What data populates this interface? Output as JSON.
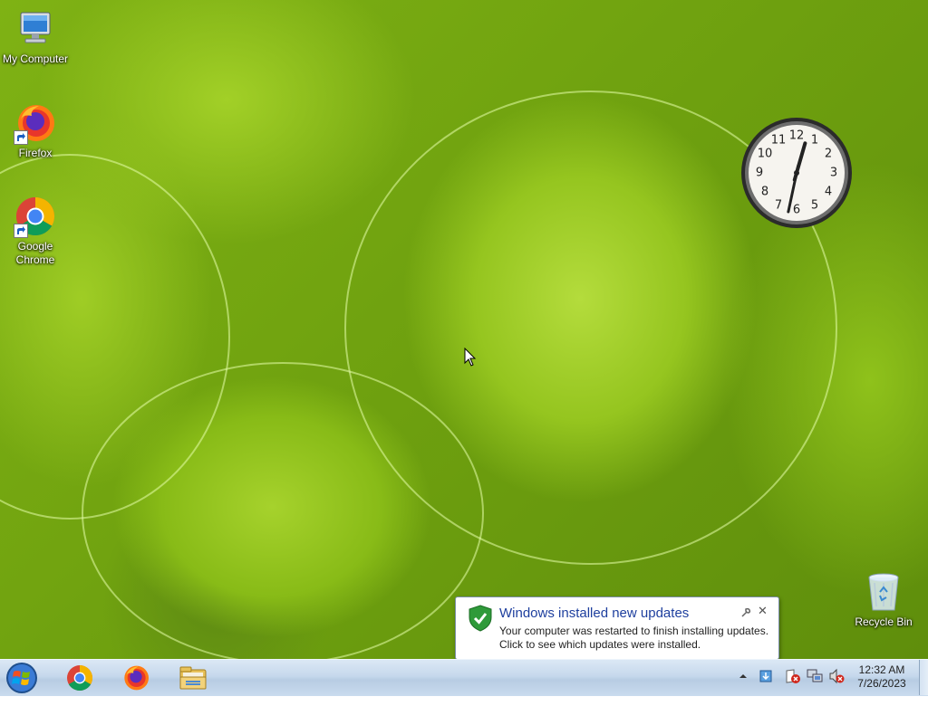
{
  "desktop": {
    "icons": [
      {
        "label": "My Computer",
        "icon": "computer-icon"
      },
      {
        "label": "Firefox",
        "icon": "firefox-icon"
      },
      {
        "label": "Google Chrome",
        "icon": "chrome-icon"
      },
      {
        "label": "Recycle Bin",
        "icon": "recycle-bin-icon"
      }
    ],
    "gadget": {
      "type": "clock",
      "hour": 12,
      "minute": 32
    }
  },
  "taskbar": {
    "start": "start-orb",
    "pinned": [
      {
        "name": "Google Chrome",
        "icon": "chrome-icon"
      },
      {
        "name": "Firefox",
        "icon": "firefox-icon"
      },
      {
        "name": "Windows Explorer",
        "icon": "folder-icon"
      }
    ],
    "tray": {
      "time": "12:32 AM",
      "date": "7/26/2023",
      "icons": [
        "show-hidden-icons-icon",
        "windows-update-icon",
        "action-center-icon",
        "network-icon",
        "volume-muted-icon"
      ]
    }
  },
  "notification": {
    "title": "Windows installed new updates",
    "line1": "Your computer was restarted to finish installing updates.",
    "line2": "Click to see which updates were installed.",
    "icon": "shield-check-icon"
  },
  "colors": {
    "title_blue": "#1e3f9e",
    "wallpaper_green": "#8fc21b",
    "taskbar": "#c6d8ec"
  }
}
